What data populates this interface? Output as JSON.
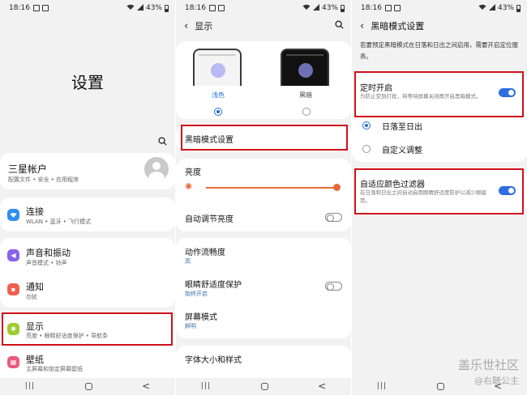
{
  "status": {
    "time": "18:16",
    "battery": "43%"
  },
  "panel1": {
    "title": "设置",
    "account": {
      "title": "三星帐户",
      "subtitle": "配置文件 • 安全 • 应用程序"
    },
    "items": [
      {
        "title": "连接",
        "subtitle": "WLAN • 蓝牙 • 飞行模式",
        "icon": "wifi-icon",
        "color": "#2f8df0"
      },
      {
        "title": "声音和振动",
        "subtitle": "声音模式 • 铃声",
        "icon": "speaker-icon",
        "color": "#8a62e8"
      },
      {
        "title": "通知",
        "subtitle": "勿扰",
        "icon": "notification-icon",
        "color": "#ef5f4f"
      },
      {
        "title": "显示",
        "subtitle": "亮度 • 眼睛舒适度保护 • 导航条",
        "icon": "sun-icon",
        "color": "#9bcd2f"
      },
      {
        "title": "壁纸",
        "subtitle": "主屏幕和锁定屏幕壁纸",
        "icon": "wallpaper-icon",
        "color": "#ea5a7e"
      }
    ]
  },
  "panel2": {
    "title": "显示",
    "light_label": "浅色",
    "dark_label": "黑暗",
    "dark_mode_settings": "黑暗模式设置",
    "brightness": "亮度",
    "brightness_level": 1.0,
    "adaptive_brightness": "自动调节亮度",
    "motion_smoothness": "动作流畅度",
    "motion_value": "高",
    "eye_comfort": "眼睛舒适度保护",
    "eye_comfort_sub": "始终开启",
    "screen_mode": "屏幕模式",
    "screen_mode_sub": "鲜明",
    "font": "字体大小和样式"
  },
  "panel3": {
    "title": "黑暗模式设置",
    "intro": "若要预定黑暗模式在日落和日出之间启用，需要开启定位服务。",
    "scheduled": {
      "title": "定时开启",
      "subtitle": "为防止受到打扰，将等待屏幕关闭再开启黑暗模式。"
    },
    "sunset": "日落至日出",
    "custom": "自定义调整",
    "adaptive_filter": {
      "title": "自适应颜色过滤器",
      "subtitle": "在日落和日出之间自动启用眼睛舒适度防护以减少眼疲劳。"
    }
  },
  "watermark": {
    "line1": "盖乐世社区",
    "line2": "@右聴公主"
  },
  "colors": {
    "accent": "#2e6ee0",
    "highlight": "#d0101a",
    "brightness": "#e86a3a"
  }
}
